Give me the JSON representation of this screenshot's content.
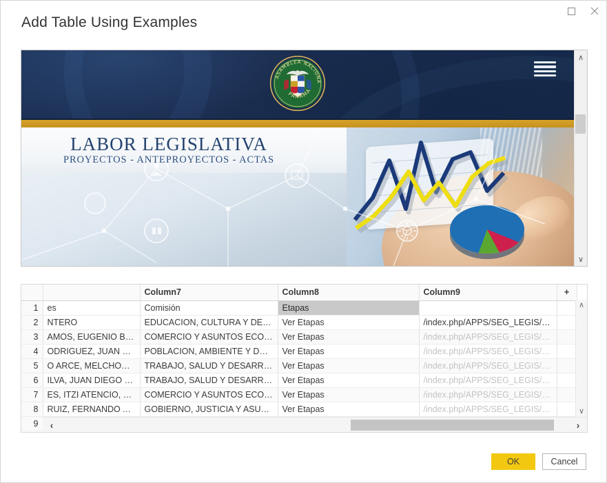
{
  "dialog": {
    "title": "Add Table Using Examples",
    "maximize_label": "Maximize",
    "close_label": "Close"
  },
  "preview": {
    "site": {
      "logo_alt": "Asamblea Nacional Panama seal",
      "logo_ring_top": "ASAMBLEA NACIONAL",
      "logo_ring_bottom": "PANAMA",
      "menu_label": "Menu"
    },
    "hero": {
      "title": "LABOR LEGISLATIVA",
      "subtitle": "PROYECTOS - ANTEPROYECTOS - ACTAS"
    },
    "scrollbar": {
      "up": "∧",
      "down": "∨"
    }
  },
  "grid": {
    "headers": [
      "",
      "",
      "Column7",
      "Column8",
      "Column9",
      "+"
    ],
    "rows": [
      {
        "num": "1",
        "a": "es",
        "b": "Comisión",
        "c": "Etapas",
        "d": "",
        "c_selected": true,
        "d_dim": false
      },
      {
        "num": "2",
        "a": "NTERO",
        "b": "EDUCACION, CULTURA Y DEPORT...",
        "c": "Ver Etapas",
        "d": "/index.php/APPS/SEG_LEGIS/PDF_...",
        "c_selected": false,
        "d_dim": false
      },
      {
        "num": "3",
        "a": "AMOS, EUGENIO BERNA...",
        "b": "COMERCIO Y ASUNTOS ECONOM...",
        "c": "Ver Etapas",
        "d": "/index.php/APPS/SEG_LEGIS/PDF_...",
        "c_selected": false,
        "d_dim": true
      },
      {
        "num": "4",
        "a": "ODRIGUEZ, JUAN DIEGO ...",
        "b": "POBLACION, AMBIENTE Y DESAR...",
        "c": "Ver Etapas",
        "d": "/index.php/APPS/SEG_LEGIS/PDF_...",
        "c_selected": false,
        "d_dim": true
      },
      {
        "num": "5",
        "a": "O ARCE, MELCHOR HER...",
        "b": "TRABAJO, SALUD Y DESARROLLO ...",
        "c": "Ver Etapas",
        "d": "/index.php/APPS/SEG_LEGIS/PDF_...",
        "c_selected": false,
        "d_dim": true
      },
      {
        "num": "6",
        "a": "ILVA, JUAN DIEGO VAS...",
        "b": "TRABAJO, SALUD Y DESARROLLO ...",
        "c": "Ver Etapas",
        "d": "/index.php/APPS/SEG_LEGIS/PDF_...",
        "c_selected": false,
        "d_dim": true
      },
      {
        "num": "7",
        "a": "ES, ITZI ATENCIO, EVER...",
        "b": "COMERCIO Y ASUNTOS ECONOM...",
        "c": "Ver Etapas",
        "d": "/index.php/APPS/SEG_LEGIS/PDF_...",
        "c_selected": false,
        "d_dim": true
      },
      {
        "num": "8",
        "a": "RUIZ, FERNANDO ARCE...",
        "b": "GOBIERNO, JUSTICIA Y ASUNTOS ...",
        "c": "Ver Etapas",
        "d": "/index.php/APPS/SEG_LEGIS/PDF_...",
        "c_selected": false,
        "d_dim": true
      },
      {
        "num": "9",
        "a": "",
        "b": "",
        "c": "",
        "d": "",
        "c_selected": false,
        "d_dim": false
      }
    ],
    "vscroll": {
      "up": "∧",
      "down": "∨"
    },
    "hscroll": {
      "left": "‹",
      "right": "›"
    }
  },
  "footer": {
    "ok_label": "OK",
    "cancel_label": "Cancel"
  },
  "colors": {
    "accent_yellow": "#F2C811",
    "header_navy": "#1b2d4f",
    "gold_band": "#c6921f",
    "hero_title_blue": "#24436f"
  }
}
